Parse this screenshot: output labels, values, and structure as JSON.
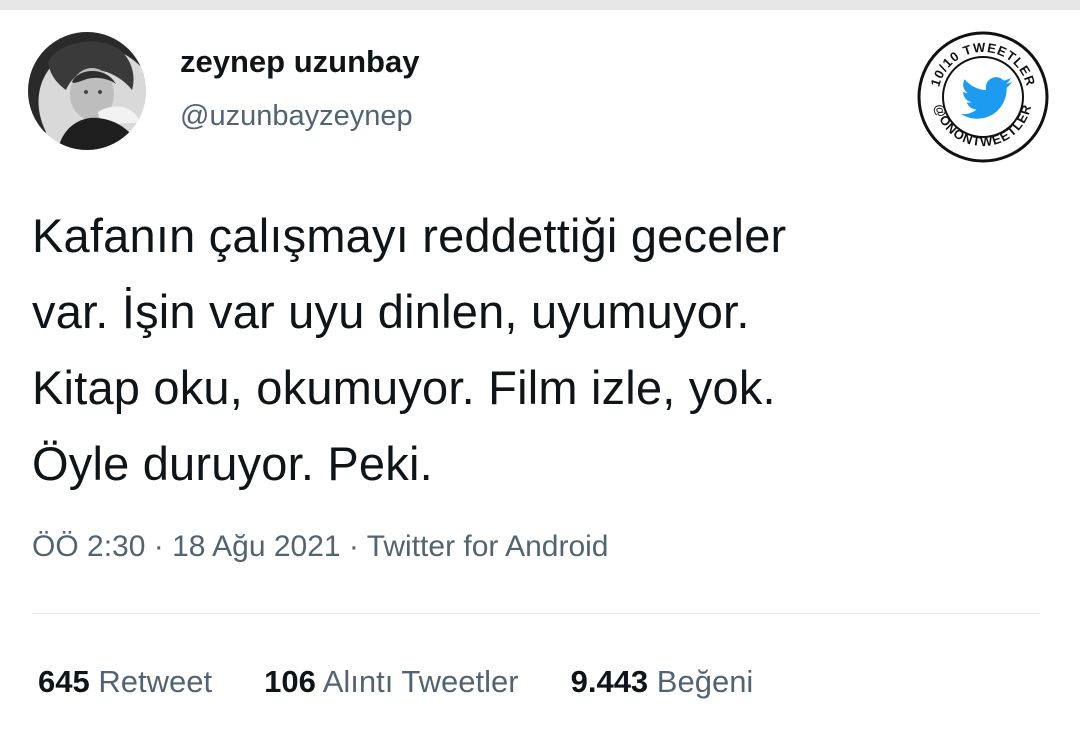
{
  "user": {
    "display_name": "zeynep uzunbay",
    "handle": "@uzunbayzeynep"
  },
  "badge": {
    "top_text": "10/10 TWEETLER",
    "bottom_text": "@ONONTWEETLER",
    "icon": "twitter-bird-icon",
    "bird_color": "#1d9bf0"
  },
  "tweet": {
    "text": "Kafanın çalışmayı reddettiği geceler\nvar.  İşin var uyu dinlen, uyumuyor.\nKitap oku, okumuyor. Film izle, yok.\nÖyle duruyor. Peki."
  },
  "meta": {
    "time": "ÖÖ 2:30",
    "separator": " · ",
    "date": "18 Ağu 2021",
    "source": "Twitter for Android"
  },
  "stats": {
    "retweets": {
      "count": "645",
      "label": "Retweet"
    },
    "quotes": {
      "count": "106",
      "label": "Alıntı Tweetler"
    },
    "likes": {
      "count": "9.443",
      "label": "Beğeni"
    }
  }
}
